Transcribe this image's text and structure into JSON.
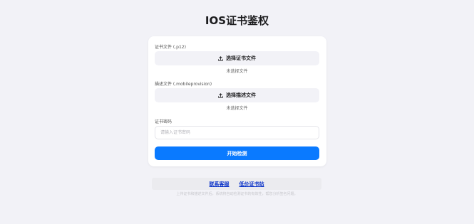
{
  "page": {
    "title": "IOS证书鉴权"
  },
  "form": {
    "cert_label": "证书文件 (.p12)",
    "cert_button": "选择证书文件",
    "cert_status": "未选择文件",
    "profile_label": "描述文件 (.mobileprovision)",
    "profile_button": "选择描述文件",
    "profile_status": "未选择文件",
    "password_label": "证书密码",
    "password_value": "",
    "password_placeholder": "请输入证书密码",
    "submit_label": "开始检测"
  },
  "footer": {
    "link_contact": "联系客服",
    "link_cheap": "低价证书站",
    "note": "上传证书和描述文件后，系统将自动检测证书的有效性，帮您分析签名问题。"
  },
  "icons": {
    "upload": "upload-icon"
  },
  "colors": {
    "background": "#f2f2f7",
    "accent": "#0a7aff",
    "link": "#0a32c8"
  }
}
